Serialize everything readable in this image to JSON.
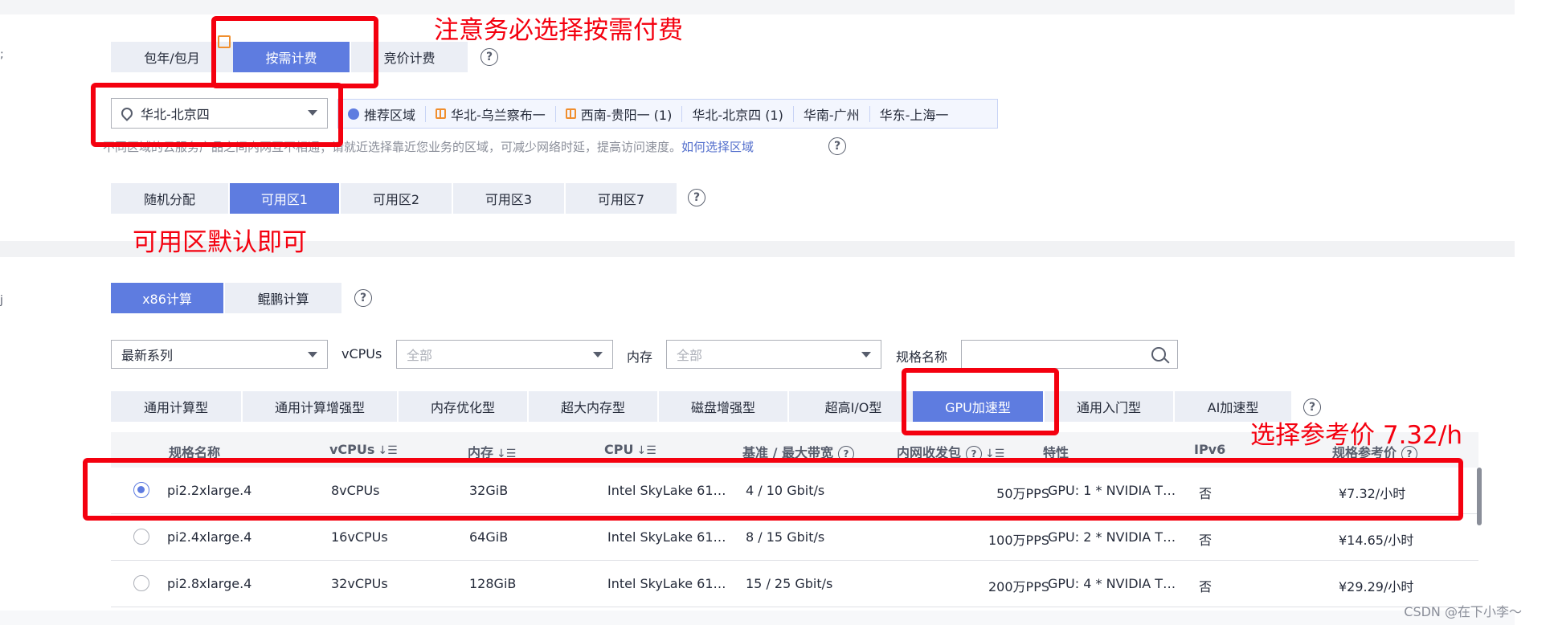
{
  "billing": {
    "tabs": [
      "包年/包月",
      "按需计费",
      "竞价计费"
    ],
    "active": "按需计费"
  },
  "region": {
    "selected": "华北-北京四",
    "quick_items": [
      "推荐区域",
      "华北-乌兰察布一",
      "西南-贵阳一 (1)",
      "华北-北京四 (1)",
      "华南-广州",
      "华东-上海一"
    ],
    "note_text": "不同区域的云服务产品之间内网互不相通；请就近选择靠近您业务的区域，可减少网络时延，提高访问速度。",
    "note_link": "如何选择区域"
  },
  "az": {
    "tabs": [
      "随机分配",
      "可用区1",
      "可用区2",
      "可用区3",
      "可用区7"
    ],
    "active": "可用区1"
  },
  "arch": {
    "tabs": [
      "x86计算",
      "鲲鹏计算"
    ],
    "active": "x86计算"
  },
  "filters": {
    "series": "最新系列",
    "vcpus_label": "vCPUs",
    "vcpus_placeholder": "全部",
    "memory_label": "内存",
    "memory_placeholder": "全部",
    "spec_label": "规格名称"
  },
  "types": {
    "tabs": [
      "通用计算型",
      "通用计算增强型",
      "内存优化型",
      "超大内存型",
      "磁盘增强型",
      "超高I/O型",
      "GPU加速型",
      "通用入门型",
      "AI加速型"
    ],
    "active": "GPU加速型"
  },
  "table": {
    "headers": [
      "规格名称",
      "vCPUs",
      "内存",
      "CPU",
      "基准 / 最大带宽",
      "内网收发包",
      "特性",
      "IPv6",
      "规格参考价"
    ],
    "sort_icon": "↓☰",
    "rows": [
      {
        "name": "pi2.2xlarge.4",
        "vcpus": "8vCPUs",
        "mem": "32GiB",
        "cpu": "Intel SkyLake 61…",
        "bw": "4 / 10 Gbit/s",
        "pps": "50万PPS",
        "feature": "GPU: 1 * NVIDIA T…",
        "ipv6": "否",
        "price": "¥7.32/小时",
        "selected": true
      },
      {
        "name": "pi2.4xlarge.4",
        "vcpus": "16vCPUs",
        "mem": "64GiB",
        "cpu": "Intel SkyLake 61…",
        "bw": "8 / 15 Gbit/s",
        "pps": "100万PPS",
        "feature": "GPU: 2 * NVIDIA T…",
        "ipv6": "否",
        "price": "¥14.65/小时",
        "selected": false
      },
      {
        "name": "pi2.8xlarge.4",
        "vcpus": "32vCPUs",
        "mem": "128GiB",
        "cpu": "Intel SkyLake 61…",
        "bw": "15 / 25 Gbit/s",
        "pps": "200万PPS",
        "feature": "GPU: 4 * NVIDIA T…",
        "ipv6": "否",
        "price": "¥29.29/小时",
        "selected": false
      }
    ]
  },
  "annotations": {
    "billing": "注意务必选择按需付费",
    "az": "可用区默认即可",
    "price": "选择参考价 7.32/h"
  },
  "watermark": "CSDN @在下小李～",
  "colors": {
    "primary": "#5e7ce0",
    "annotation": "#f4000f"
  }
}
